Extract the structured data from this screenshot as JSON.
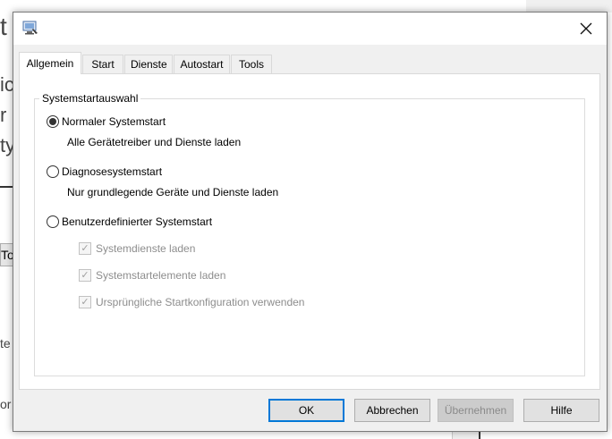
{
  "background": {
    "fragments": [
      "t",
      "ic",
      "r s",
      "ty",
      "To",
      "te",
      "or"
    ]
  },
  "dialog": {
    "close_icon": "close-icon",
    "tabs": [
      {
        "label": "Allgemein",
        "active": true
      },
      {
        "label": "Start",
        "active": false
      },
      {
        "label": "Dienste",
        "active": false
      },
      {
        "label": "Autostart",
        "active": false
      },
      {
        "label": "Tools",
        "active": false
      }
    ],
    "group_title": "Systemstartauswahl",
    "options": [
      {
        "label": "Normaler Systemstart",
        "description": "Alle Gerätetreiber und Dienste laden",
        "selected": true
      },
      {
        "label": "Diagnosesystemstart",
        "description": "Nur grundlegende Geräte und Dienste laden",
        "selected": false
      },
      {
        "label": "Benutzerdefinierter Systemstart",
        "description": "",
        "selected": false
      }
    ],
    "checkboxes": [
      {
        "label": "Systemdienste laden",
        "checked": true,
        "enabled": false
      },
      {
        "label": "Systemstartelemente laden",
        "checked": true,
        "enabled": false
      },
      {
        "label": "Ursprüngliche Startkonfiguration verwenden",
        "checked": true,
        "enabled": false
      }
    ],
    "buttons": {
      "ok": "OK",
      "cancel": "Abbrechen",
      "apply": "Übernehmen",
      "help": "Hilfe"
    }
  },
  "colors": {
    "accent": "#0078d7",
    "dialog_bg": "#f0f0f0",
    "disabled_text": "#8d8d8d"
  }
}
